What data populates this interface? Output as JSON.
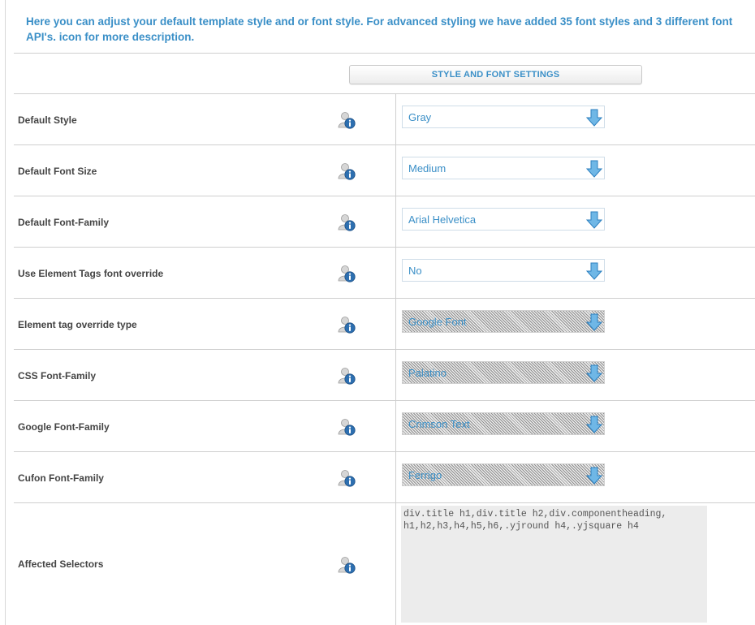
{
  "intro_text": "Here you can adjust your default template style and or font style. For advanced styling we have added 35 font styles and 3 different font API's. icon for more description.",
  "header": {
    "button_label": "STYLE AND FONT SETTINGS"
  },
  "rows": [
    {
      "label": "Default Style",
      "value": "Gray",
      "disabled": false
    },
    {
      "label": "Default Font Size",
      "value": "Medium",
      "disabled": false
    },
    {
      "label": "Default Font-Family",
      "value": "Arial Helvetica",
      "disabled": false
    },
    {
      "label": "Use Element Tags font override",
      "value": "No",
      "disabled": false
    },
    {
      "label": "Element tag override type",
      "value": "Google Font",
      "disabled": true
    },
    {
      "label": "CSS Font-Family",
      "value": "Palatino",
      "disabled": true
    },
    {
      "label": "Google Font-Family",
      "value": "Crimson Text",
      "disabled": true
    },
    {
      "label": "Cufon Font-Family",
      "value": "Ferrigo",
      "disabled": true
    }
  ],
  "affected": {
    "label": "Affected Selectors",
    "value": "div.title h1,div.title h2,div.componentheading,\nh1,h2,h3,h4,h5,h6,.yjround h4,.yjsquare h4"
  },
  "icons": {
    "info": "user-info-icon",
    "dropdown": "arrow-down-icon"
  },
  "colors": {
    "accent": "#3a8fc7",
    "label": "#444444",
    "border": "#cfcfcf"
  }
}
